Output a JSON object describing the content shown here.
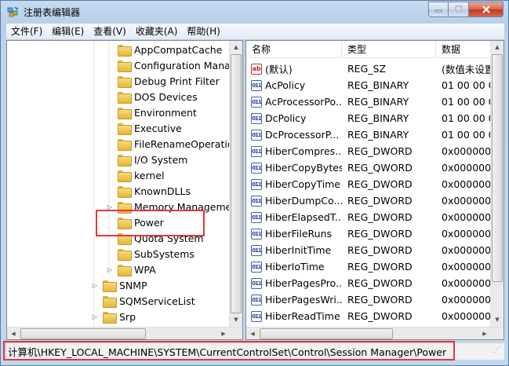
{
  "window": {
    "title": "注册表编辑器",
    "minimize_icon": "minimize-icon",
    "maximize_icon": "maximize-icon",
    "close_icon": "close-icon"
  },
  "menu": [
    "文件(F)",
    "编辑(E)",
    "查看(V)",
    "收藏夹(A)",
    "帮助(H)"
  ],
  "tree": [
    {
      "label": "AppCompatCache",
      "level": 2,
      "expander": ""
    },
    {
      "label": "Configuration Manag",
      "level": 2,
      "expander": ""
    },
    {
      "label": "Debug Print Filter",
      "level": 2,
      "expander": ""
    },
    {
      "label": "DOS Devices",
      "level": 2,
      "expander": ""
    },
    {
      "label": "Environment",
      "level": 2,
      "expander": ""
    },
    {
      "label": "Executive",
      "level": 2,
      "expander": ""
    },
    {
      "label": "FileRenameOperation",
      "level": 2,
      "expander": ""
    },
    {
      "label": "I/O System",
      "level": 2,
      "expander": ""
    },
    {
      "label": "kernel",
      "level": 2,
      "expander": ""
    },
    {
      "label": "KnownDLLs",
      "level": 2,
      "expander": ""
    },
    {
      "label": "Memory Managemer",
      "level": 2,
      "expander": "▷"
    },
    {
      "label": "Power",
      "level": 2,
      "expander": "",
      "selected": true
    },
    {
      "label": "Quota System",
      "level": 2,
      "expander": ""
    },
    {
      "label": "SubSystems",
      "level": 2,
      "expander": ""
    },
    {
      "label": "WPA",
      "level": 2,
      "expander": "▷"
    },
    {
      "label": "SNMP",
      "level": 1,
      "expander": "▷"
    },
    {
      "label": "SQMServiceList",
      "level": 1,
      "expander": ""
    },
    {
      "label": "Srp",
      "level": 1,
      "expander": "▷"
    }
  ],
  "list": {
    "columns": [
      "名称",
      "类型",
      "数据"
    ],
    "rows": [
      {
        "icon": "string",
        "name": "(默认)",
        "type": "REG_SZ",
        "data": "(数值未设置"
      },
      {
        "icon": "binary",
        "name": "AcPolicy",
        "type": "REG_BINARY",
        "data": "01 00 00 0"
      },
      {
        "icon": "binary",
        "name": "AcProcessorPo...",
        "type": "REG_BINARY",
        "data": "01 00 00 0"
      },
      {
        "icon": "binary",
        "name": "DcPolicy",
        "type": "REG_BINARY",
        "data": "01 00 00 0"
      },
      {
        "icon": "binary",
        "name": "DcProcessorP...",
        "type": "REG_BINARY",
        "data": "01 00 00 0"
      },
      {
        "icon": "binary",
        "name": "HiberCompres...",
        "type": "REG_DWORD",
        "data": "0x0000000"
      },
      {
        "icon": "binary",
        "name": "HiberCopyBytes",
        "type": "REG_QWORD",
        "data": "0x0000000"
      },
      {
        "icon": "binary",
        "name": "HiberCopyTime",
        "type": "REG_DWORD",
        "data": "0x0000000"
      },
      {
        "icon": "binary",
        "name": "HiberDumpCo...",
        "type": "REG_DWORD",
        "data": "0x0000000"
      },
      {
        "icon": "binary",
        "name": "HiberElapsedT...",
        "type": "REG_DWORD",
        "data": "0x0000000"
      },
      {
        "icon": "binary",
        "name": "HiberFileRuns",
        "type": "REG_DWORD",
        "data": "0x0000000"
      },
      {
        "icon": "binary",
        "name": "HiberInitTime",
        "type": "REG_DWORD",
        "data": "0x0000000"
      },
      {
        "icon": "binary",
        "name": "HiberIoTime",
        "type": "REG_DWORD",
        "data": "0x0000000"
      },
      {
        "icon": "binary",
        "name": "HiberPagesPro...",
        "type": "REG_DWORD",
        "data": "0x0000000"
      },
      {
        "icon": "binary",
        "name": "HiberPagesWri...",
        "type": "REG_DWORD",
        "data": "0x0000000"
      },
      {
        "icon": "binary",
        "name": "HiberReadTime",
        "type": "REG_DWORD",
        "data": "0x0000000"
      }
    ]
  },
  "status": {
    "path": "计算机\\HKEY_LOCAL_MACHINE\\SYSTEM\\CurrentControlSet\\Control\\Session Manager\\Power"
  },
  "colors": {
    "highlight": "#e0383f",
    "folder": "#f2c94c",
    "close_button": "#c2381c"
  }
}
